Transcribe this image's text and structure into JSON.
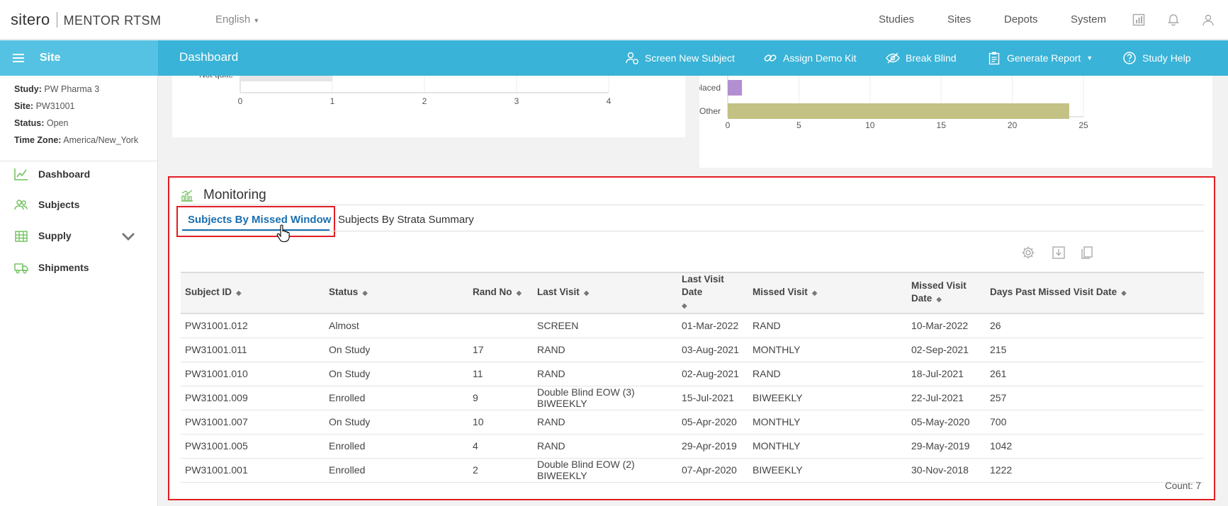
{
  "app": {
    "logo_sitero": "sitero",
    "logo_product": "MENTOR RTSM"
  },
  "header": {
    "language": "English",
    "nav": [
      "Studies",
      "Sites",
      "Depots",
      "System"
    ],
    "icons": [
      "report-icon",
      "bell-icon",
      "user-icon"
    ]
  },
  "bluebar": {
    "site_label": "Site",
    "page_title": "Dashboard",
    "actions": [
      {
        "label": "Screen New Subject",
        "icon": "user-add-icon"
      },
      {
        "label": "Assign Demo Kit",
        "icon": "link-icon"
      },
      {
        "label": "Break Blind",
        "icon": "eye-icon"
      },
      {
        "label": "Generate Report",
        "icon": "clipboard-icon",
        "dropdown": true
      },
      {
        "label": "Study Help",
        "icon": "help-icon"
      }
    ]
  },
  "sidebar": {
    "meta": [
      {
        "label": "Study:",
        "value": "PW Pharma 3"
      },
      {
        "label": "Site:",
        "value": "PW31001"
      },
      {
        "label": "Status:",
        "value": "Open"
      },
      {
        "label": "Time Zone:",
        "value": "America/New_York"
      }
    ],
    "items": [
      {
        "label": "Dashboard",
        "icon": "chart-line-icon"
      },
      {
        "label": "Subjects",
        "icon": "users-icon"
      },
      {
        "label": "Supply",
        "icon": "supply-icon",
        "expandable": true
      },
      {
        "label": "Shipments",
        "icon": "truck-icon"
      }
    ]
  },
  "chart_data": [
    {
      "type": "bar",
      "orientation": "horizontal",
      "categories": [
        "Not quite"
      ],
      "values": [
        1
      ],
      "xlim": [
        0,
        4
      ],
      "xticks": [
        "0",
        "1",
        "2",
        "3",
        "4"
      ],
      "colors": [
        "#e6e6e6"
      ]
    },
    {
      "type": "bar",
      "orientation": "horizontal",
      "categories": [
        "Replaced",
        "Other"
      ],
      "values": [
        1,
        24
      ],
      "xlim": [
        0,
        25
      ],
      "xticks": [
        "0",
        "5",
        "10",
        "15",
        "20",
        "25"
      ],
      "colors": [
        "#b38fd1",
        "#c3c184"
      ]
    }
  ],
  "monitoring": {
    "title": "Monitoring",
    "tabs": [
      "Subjects By Missed Window",
      "Subjects By Strata Summary"
    ],
    "active_tab": 0,
    "toolbar_icons": [
      "settings-icon",
      "download-icon",
      "copy-icon"
    ],
    "columns": [
      "Subject ID",
      "Status",
      "Rand No",
      "Last Visit",
      "Last Visit Date",
      "Missed Visit",
      "Missed Visit Date",
      "Days Past Missed Visit Date"
    ],
    "rows": [
      [
        "PW31001.012",
        "Almost",
        "",
        "SCREEN",
        "01-Mar-2022",
        "RAND",
        "10-Mar-2022",
        "26"
      ],
      [
        "PW31001.011",
        "On Study",
        "17",
        "RAND",
        "03-Aug-2021",
        "MONTHLY",
        "02-Sep-2021",
        "215"
      ],
      [
        "PW31001.010",
        "On Study",
        "11",
        "RAND",
        "02-Aug-2021",
        "RAND",
        "18-Jul-2021",
        "261"
      ],
      [
        "PW31001.009",
        "Enrolled",
        "9",
        "Double Blind EOW (3) BIWEEKLY",
        "15-Jul-2021",
        "BIWEEKLY",
        "22-Jul-2021",
        "257"
      ],
      [
        "PW31001.007",
        "On Study",
        "10",
        "RAND",
        "05-Apr-2020",
        "MONTHLY",
        "05-May-2020",
        "700"
      ],
      [
        "PW31001.005",
        "Enrolled",
        "4",
        "RAND",
        "29-Apr-2019",
        "MONTHLY",
        "29-May-2019",
        "1042"
      ],
      [
        "PW31001.001",
        "Enrolled",
        "2",
        "Double Blind EOW (2) BIWEEKLY",
        "07-Apr-2020",
        "BIWEEKLY",
        "30-Nov-2018",
        "1222"
      ]
    ],
    "count_label": "Count: 7"
  },
  "colors": {
    "brand_blue": "#39b3d7",
    "highlight_red": "#e01e24",
    "active_tab": "#1a6fb0"
  }
}
